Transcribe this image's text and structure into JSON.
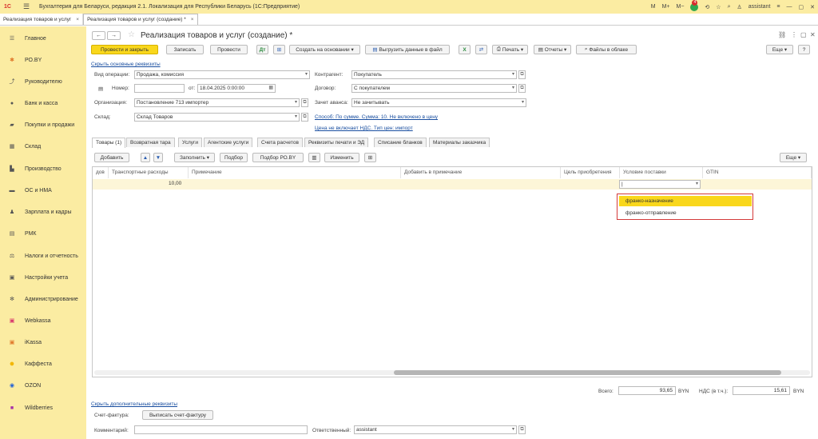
{
  "titlebar": {
    "logo": "1С",
    "app_title": "Бухгалтерия для Беларуси, редакция 2.1. Локализация для Республики Беларусь   (1С:Предприятие)",
    "m": "M",
    "m_plus": "M+",
    "m_minus": "M−",
    "badge": "4",
    "user": "assistant"
  },
  "tabs": [
    {
      "label": "Реализация товаров и услуг",
      "close": "×"
    },
    {
      "label": "Реализация товаров и услуг (создание) *",
      "close": "×"
    }
  ],
  "sidebar": [
    {
      "label": "Главное",
      "icon": "menu-icon"
    },
    {
      "label": "РО.BY",
      "icon": "ro-icon"
    },
    {
      "label": "Руководителю",
      "icon": "chart-icon"
    },
    {
      "label": "Банк и касса",
      "icon": "bank-icon"
    },
    {
      "label": "Покупки и продажи",
      "icon": "cart-icon"
    },
    {
      "label": "Склад",
      "icon": "warehouse-icon"
    },
    {
      "label": "Производство",
      "icon": "factory-icon"
    },
    {
      "label": "ОС и НМА",
      "icon": "assets-icon"
    },
    {
      "label": "Зарплата и кадры",
      "icon": "people-icon"
    },
    {
      "label": "РМК",
      "icon": "register-icon"
    },
    {
      "label": "Налоги и отчетность",
      "icon": "tax-icon"
    },
    {
      "label": "Настройки учета",
      "icon": "settings-icon"
    },
    {
      "label": "Администрирование",
      "icon": "gear-icon"
    },
    {
      "label": "Webkassa",
      "icon": "webkassa-icon"
    },
    {
      "label": "iKassa",
      "icon": "ikassa-icon"
    },
    {
      "label": "Каффеста",
      "icon": "kaffesta-icon"
    },
    {
      "label": "OZON",
      "icon": "ozon-icon"
    },
    {
      "label": "Wildberries",
      "icon": "wildberries-icon"
    }
  ],
  "doc": {
    "title": "Реализация товаров и услуг (создание) *",
    "buttons": {
      "post_close": "Провести и закрыть",
      "save": "Записать",
      "post": "Провести",
      "create_based": "Создать на основании",
      "export": "Выгрузить данные в файл",
      "print": "Печать",
      "reports": "Отчеты",
      "cloud": "Файлы в облаке",
      "more": "Еще"
    },
    "hide_link": "Скрыть основные реквизиты",
    "fields": {
      "op_type_label": "Вид операции:",
      "op_type": "Продажа, комиссия",
      "number_label": "Номер:",
      "number": "",
      "from_label": "от:",
      "date": "18.04.2025  0:00:00",
      "org_label": "Организация:",
      "org": "Постановление 713 импортер",
      "warehouse_label": "Склад:",
      "warehouse": "Склад Товаров",
      "counterparty_label": "Контрагент:",
      "counterparty": "Покупатель",
      "contract_label": "Договор:",
      "contract": "С покупателем",
      "advance_label": "Зачет аванса:",
      "advance": "Не зачитывать",
      "method_link": "Способ: По сумме. Сумма: 10. Не включено в цену",
      "price_link": "Цена не включает НДС. Тип цен: импорт"
    },
    "inner_tabs": [
      "Товары (1)",
      "Возвратная тара",
      "Услуги",
      "Агентские услуги",
      "Счета расчетов",
      "Реквизиты печати и ЭД",
      "Списание бланков",
      "Материалы заказчика"
    ],
    "table_toolbar": {
      "add": "Добавить",
      "fill": "Заполнить",
      "pick": "Подбор",
      "pick_ro": "Подбор РО.BY",
      "change": "Изменить",
      "more": "Еще"
    },
    "columns": [
      "дов",
      "Транспортные расходы",
      "Примечание",
      "Добавить в примечание",
      "Цель приобретения",
      "Условие поставки",
      "GTIN"
    ],
    "row": {
      "transport": "10,00"
    },
    "dropdown": {
      "options": [
        "франко-назначение",
        "франко-отправление"
      ],
      "selected": 0
    },
    "totals": {
      "total_label": "Всего:",
      "total": "93,65",
      "currency": "BYN",
      "vat_label": "НДС (в т.ч.):",
      "vat": "15,61",
      "vat_currency": "BYN"
    },
    "footer": {
      "extra_link": "Скрыть дополнительные реквизиты",
      "invoice_label": "Счет-фактура:",
      "invoice_button": "Выписать счет-фактуру",
      "comment_label": "Комментарий:",
      "comment": "",
      "responsible_label": "Ответственный:",
      "responsible": "assistant"
    }
  }
}
